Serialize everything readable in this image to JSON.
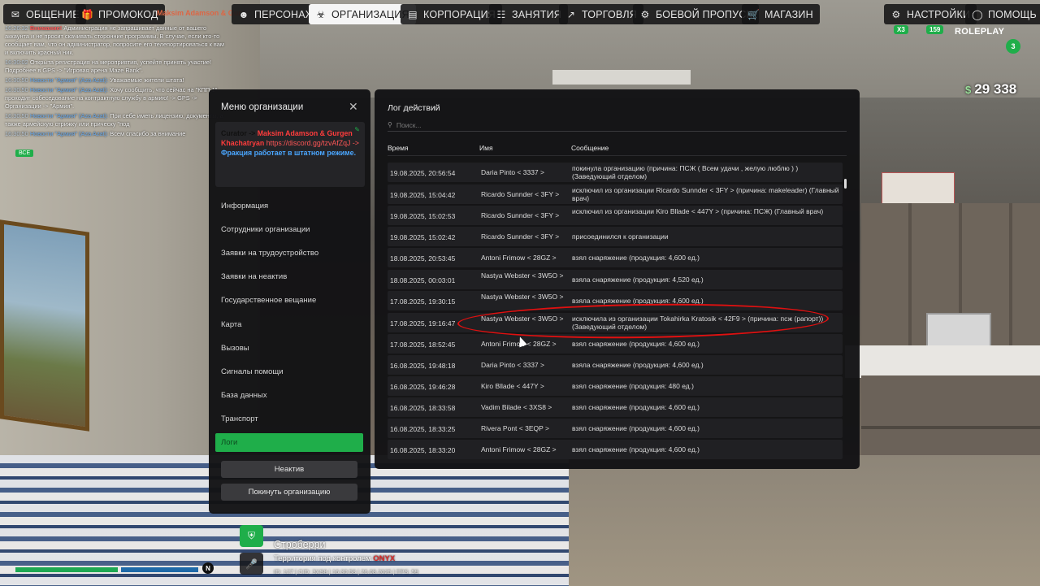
{
  "topnav": {
    "items": [
      {
        "key": "chat",
        "label": "ОБЩЕНИЕ",
        "icon": "chat-icon"
      },
      {
        "key": "promo",
        "label": "ПРОМОКОД",
        "icon": "gift-icon"
      },
      {
        "key": "character",
        "label": "ПЕРСОНАЖ",
        "icon": "user-icon"
      },
      {
        "key": "organization",
        "label": "ОРГАНИЗАЦИЯ",
        "icon": "organization-icon",
        "active": true
      },
      {
        "key": "corporation",
        "label": "КОРПОРАЦИЯ",
        "icon": "corporation-icon"
      },
      {
        "key": "activities",
        "label": "ЗАНЯТИЯ",
        "icon": "calendar-icon"
      },
      {
        "key": "trade",
        "label": "ТОРГОВЛЯ",
        "icon": "chart-icon"
      },
      {
        "key": "battlepass",
        "label": "БОЕВОЙ ПРОПУСК",
        "icon": "gear-icon"
      },
      {
        "key": "shop",
        "label": "МАГАЗИН",
        "icon": "cart-icon"
      },
      {
        "key": "settings",
        "label": "НАСТРОЙКИ",
        "icon": "gear-icon"
      },
      {
        "key": "help",
        "label": "ПОМОЩЬ",
        "icon": "help-icon"
      }
    ],
    "news_title": "Maksim Adamson & Gur"
  },
  "chat": {
    "lines": [
      {
        "time": "16:26:32",
        "tag": "Внимание!",
        "text": "Администрация не запрашивает данные от вашего аккаунта и не просит скачивать сторонние программы. В случае, если кто-то сообщает вам, что он администратор, попросите его телепортироваться к вам и включить красный ник."
      },
      {
        "time": "16:30:02",
        "tag": "",
        "text": "Открыта регистрация на мероприятия, успейте принять участие! Подробнее в GPS -> \"Игровая арена Maze Bank\"."
      },
      {
        "time": "16:30:50",
        "tag": "Новости \"Армия\" (Aza Azat):",
        "text": "Уважаемые жители штата!"
      },
      {
        "time": "16:30:50",
        "tag": "Новости \"Армия\" (Aza Azat):",
        "text": "Хочу сообщить, что сейчас на \"КПП-1\" проходит собеседование на контрактную службу в армию! -> GPS -> Организации -> \"Армия\"."
      },
      {
        "time": "16:30:50",
        "tag": "Новости \"Армия\" (Aza Azat):",
        "text": "При себе иметь лицензию, документы, а также армейскую стрижку или прическу \"под"
      },
      {
        "time": "16:30:50",
        "tag": "Новости \"Армия\" (Aza Azat):",
        "text": "Всем спасибо за внимание"
      }
    ],
    "all_label": "ВСЕ"
  },
  "hud": {
    "money": "29 338",
    "logo_line": "ROLEPLAY",
    "logo_badge": "3",
    "pill_x3": "X3",
    "pill_159": "159"
  },
  "org_menu": {
    "title": "Меню организации",
    "curator_label": "Curator ->",
    "curator_names": "Maksim Adamson & Gurgen Khachatryan",
    "curator_link": "https://discord.gg/tzvAfZqJ ->",
    "curator_status": "Фракция работает в штатном режиме.",
    "items": [
      "Информация",
      "Сотрудники организации",
      "Заявки на трудоустройство",
      "Заявки на неактив",
      "Государственное вещание",
      "Карта",
      "Вызовы",
      "Сигналы помощи",
      "База данных",
      "Транспорт",
      "Логи"
    ],
    "inactive_button": "Неактив",
    "leave_button": "Покинуть организацию"
  },
  "log": {
    "title": "Лог действий",
    "search_placeholder": "Поиск...",
    "columns": {
      "time": "Время",
      "name": "Имя",
      "message": "Сообщение"
    },
    "rows": [
      {
        "time": "19.08.2025, 20:56:54",
        "name": "Daria Pinto < 3337 >",
        "message": "покинула организацию (причина: ПСЖ ( Всем удачи , желую люблю ) ) (Заведующий отделом)"
      },
      {
        "time": "19.08.2025, 15:04:42",
        "name": "Ricardo Sunnder < 3FY >",
        "message": "исключил из организации Ricardo Sunnder < 3FY > (причина: makeleader) (Главный врач)"
      },
      {
        "time": "19.08.2025, 15:02:53",
        "name": "Ricardo Sunnder < 3FY >",
        "message": "исключил из организации Kiro Bllade < 447Y > (причина: ПСЖ) (Главный врач)"
      },
      {
        "time": "19.08.2025, 15:02:42",
        "name": "Ricardo Sunnder < 3FY >",
        "message": "присоединился к организации"
      },
      {
        "time": "18.08.2025, 20:53:45",
        "name": "Antoni Frimow < 28GZ >",
        "message": "взял снаряжение (продукция: 4,600 ед.)"
      },
      {
        "time": "18.08.2025, 00:03:01",
        "name": "Nastya Webster < 3W5O >",
        "message": "взяла снаряжение (продукция: 4,520 ед.)"
      },
      {
        "time": "17.08.2025, 19:30:15",
        "name": "Nastya Webster < 3W5O >",
        "message": "взяла снаряжение (продукция: 4,600 ед.)"
      },
      {
        "time": "17.08.2025, 19:16:47",
        "name": "Nastya Webster < 3W5O >",
        "message": "исключила из организации Tokahirka Kratosik < 42F9 > (причина: псж (рапорт)) (Заведующий отделом)"
      },
      {
        "time": "17.08.2025, 18:52:45",
        "name": "Antoni Frimow < 28GZ >",
        "message": "взял снаряжение (продукция: 4,600 ед.)"
      },
      {
        "time": "16.08.2025, 19:48:18",
        "name": "Daria Pinto < 3337 >",
        "message": "взяла снаряжение (продукция: 4,600 ед.)"
      },
      {
        "time": "16.08.2025, 19:46:28",
        "name": "Kiro Bllade < 447Y >",
        "message": "взял снаряжение (продукция: 480 ед.)"
      },
      {
        "time": "16.08.2025, 18:33:58",
        "name": "Vadim Bilade < 3XS8 >",
        "message": "взял снаряжение (продукция: 4,600 ед.)"
      },
      {
        "time": "16.08.2025, 18:33:25",
        "name": "Rivera Pont < 3EQP >",
        "message": "взял снаряжение (продукция: 4,600 ед.)"
      },
      {
        "time": "16.08.2025, 18:33:20",
        "name": "Antoni Frimow < 28GZ >",
        "message": "взял снаряжение (продукция: 4,600 ед.)"
      }
    ]
  },
  "zone": {
    "name": "Строберри",
    "owner_prefix": "Территория под контролем",
    "owner_gang": "ONYX",
    "stats": "ID: 127 | CID: 3XS8 | 16:30:58 | 26.08.2025 | FPS: 59",
    "compass": "N"
  },
  "colors": {
    "accent": "#1fae4a",
    "panel": "#121214",
    "highlight_circle": "#e01010"
  }
}
